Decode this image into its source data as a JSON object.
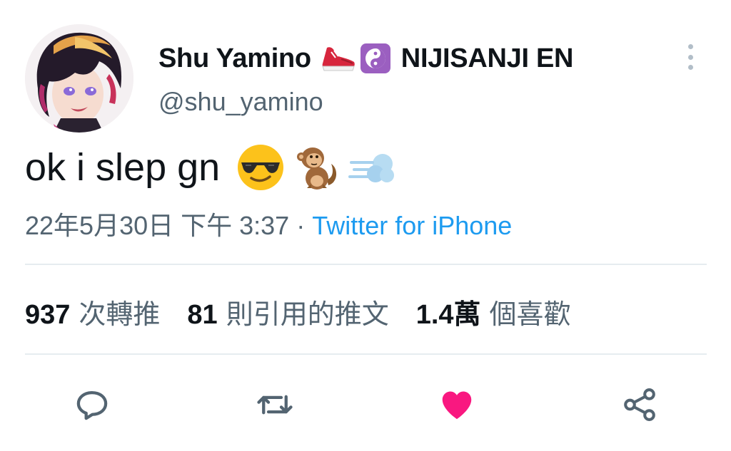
{
  "author": {
    "display_name": "Shu Yamino",
    "affiliation": "NIJISANJI EN",
    "handle": "@shu_yamino",
    "name_emojis": [
      "sneaker-emoji",
      "yin-yang-emoji"
    ]
  },
  "tweet": {
    "text": "ok i slep gn",
    "emojis": [
      "sunglasses-face-emoji",
      "monkey-emoji",
      "dash-emoji"
    ],
    "timestamp": "22年5月30日 下午 3:37",
    "separator": " · ",
    "source": "Twitter for iPhone"
  },
  "stats": {
    "retweets_count": "937",
    "retweets_label": "次轉推",
    "quotes_count": "81",
    "quotes_label": "則引用的推文",
    "likes_count": "1.4萬",
    "likes_label": "個喜歡"
  },
  "actions": {
    "reply_icon": "reply-icon",
    "retweet_icon": "retweet-icon",
    "like_icon": "heart-icon",
    "like_active": true,
    "share_icon": "share-icon"
  },
  "colors": {
    "text_primary": "#0f1419",
    "text_secondary": "#536471",
    "link": "#1d9bf0",
    "like": "#f91880",
    "icon": "#536471",
    "divider": "#e6ecf0"
  }
}
